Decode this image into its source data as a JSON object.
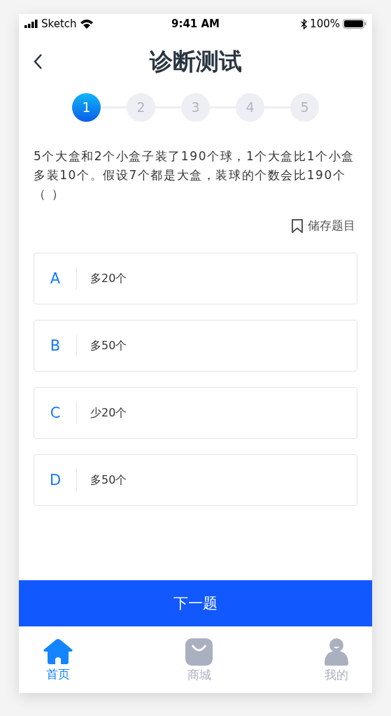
{
  "status_bar": {
    "carrier": "Sketch",
    "time": "9:41 AM",
    "battery": "100%"
  },
  "header": {
    "title": "诊断测试"
  },
  "steps": [
    {
      "label": "1",
      "selected": true
    },
    {
      "label": "2",
      "selected": false
    },
    {
      "label": "3",
      "selected": false
    },
    {
      "label": "4",
      "selected": false
    },
    {
      "label": "5",
      "selected": false
    }
  ],
  "question": {
    "text": "5个大盒和2个小盒子装了190个球，1个大盒比1个小盒多装10个。假设7个都是大盒，装球的个数会比190个（ ）",
    "save_label": "储存题目"
  },
  "options": [
    {
      "letter": "A",
      "text": "多20个",
      "selected": false
    },
    {
      "letter": "B",
      "text": "多50个",
      "selected": false
    },
    {
      "letter": "C",
      "text": "少20个",
      "selected": false
    },
    {
      "letter": "D",
      "text": "多50个",
      "selected": false
    }
  ],
  "next_button": "下一题",
  "tab_bar": [
    {
      "kind": "home",
      "label": "首页",
      "selected": true
    },
    {
      "kind": "shop",
      "label": "商城",
      "selected": false
    },
    {
      "kind": "profile",
      "label": "我的",
      "selected": false
    }
  ]
}
